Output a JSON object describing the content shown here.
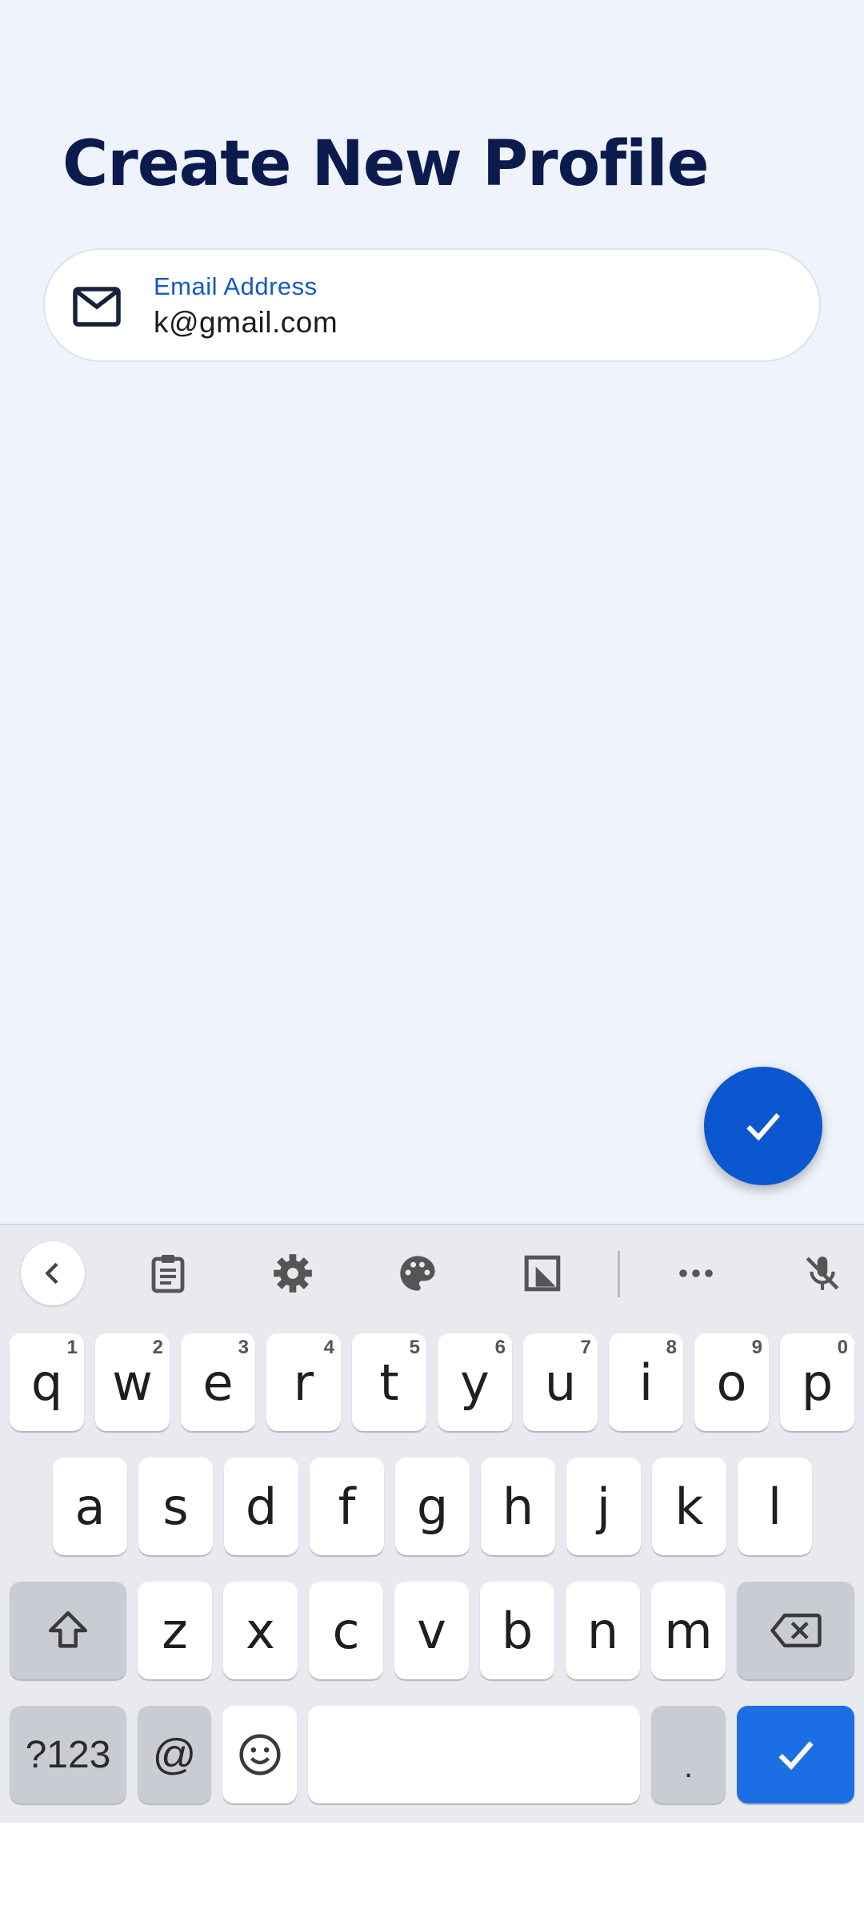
{
  "page": {
    "title": "Create New Profile"
  },
  "email_field": {
    "label": "Email Address",
    "value": "k@gmail.com",
    "icon": "mail-icon"
  },
  "fab": {
    "icon": "check-icon"
  },
  "colors": {
    "background": "#eff3fc",
    "title": "#0c1b4d",
    "accent": "#0b57d0",
    "label": "#1459c7",
    "keyboard": "#e8eaef",
    "enter_key": "#1b6ee3"
  },
  "keyboard": {
    "toolbar": [
      "back-icon",
      "clipboard-icon",
      "settings-icon",
      "palette-icon",
      "resize-icon",
      "more-icon",
      "mic-off-icon"
    ],
    "row1": [
      {
        "key": "q",
        "hint": "1"
      },
      {
        "key": "w",
        "hint": "2"
      },
      {
        "key": "e",
        "hint": "3"
      },
      {
        "key": "r",
        "hint": "4"
      },
      {
        "key": "t",
        "hint": "5"
      },
      {
        "key": "y",
        "hint": "6"
      },
      {
        "key": "u",
        "hint": "7"
      },
      {
        "key": "i",
        "hint": "8"
      },
      {
        "key": "o",
        "hint": "9"
      },
      {
        "key": "p",
        "hint": "0"
      }
    ],
    "row2": [
      "a",
      "s",
      "d",
      "f",
      "g",
      "h",
      "j",
      "k",
      "l"
    ],
    "row3": [
      "z",
      "x",
      "c",
      "v",
      "b",
      "n",
      "m"
    ],
    "row4": {
      "symbols": "?123",
      "at": "@",
      "period": "."
    }
  }
}
